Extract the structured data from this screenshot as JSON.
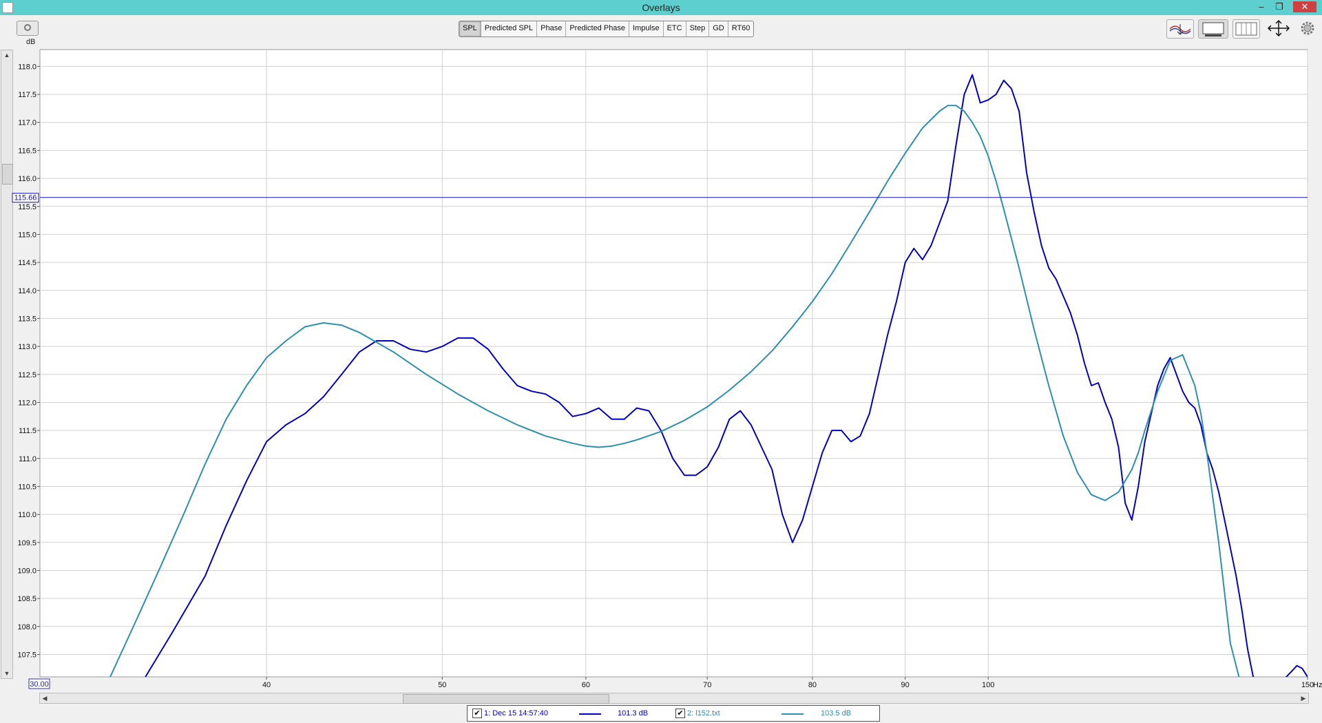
{
  "window": {
    "title": "Overlays",
    "minimize": "–",
    "restore": "❐",
    "close": "✕"
  },
  "toolbar": {
    "unit_label": "dB",
    "tabs": [
      {
        "label": "SPL",
        "active": true
      },
      {
        "label": "Predicted SPL",
        "active": false
      },
      {
        "label": "Phase",
        "active": false
      },
      {
        "label": "Predicted Phase",
        "active": false
      },
      {
        "label": "Impulse",
        "active": false
      },
      {
        "label": "ETC",
        "active": false
      },
      {
        "label": "Step",
        "active": false
      },
      {
        "label": "GD",
        "active": false
      },
      {
        "label": "RT60",
        "active": false
      }
    ],
    "icons": [
      "camera-icon",
      "traces-icon",
      "panel-icon",
      "columns-icon",
      "resize-arrows-icon",
      "gear-icon"
    ]
  },
  "cursor": {
    "value": 115.66,
    "label": "115.66"
  },
  "x_start_label": "30.00",
  "x_unit": "Hz",
  "chart_data": {
    "type": "line",
    "xscale": "log",
    "xlim": [
      30,
      150
    ],
    "ylim": [
      107.1,
      118.3
    ],
    "xticks": [
      40,
      50,
      60,
      70,
      80,
      90,
      100,
      150
    ],
    "yticks": [
      107.5,
      108.0,
      108.5,
      109.0,
      109.5,
      110.0,
      110.5,
      111.0,
      111.5,
      112.0,
      112.5,
      113.0,
      113.5,
      114.0,
      114.5,
      115.0,
      115.5,
      116.0,
      116.5,
      117.0,
      117.5,
      118.0
    ],
    "grid": true,
    "series": [
      {
        "name": "1: Dec 15 14:57:40",
        "level": "101.3 dB",
        "color": "#0000c0",
        "x": [
          34.3,
          35.5,
          37.0,
          38.0,
          39.0,
          40.0,
          41.0,
          42.0,
          43.0,
          44.0,
          45.0,
          46.0,
          47.0,
          48.0,
          49.0,
          50.0,
          51.0,
          52.0,
          53.0,
          54.0,
          55.0,
          56.0,
          57.0,
          58.0,
          59.0,
          60.0,
          61.0,
          62.0,
          63.0,
          64.0,
          65.0,
          66.0,
          67.0,
          68.0,
          69.0,
          70.0,
          71.0,
          72.0,
          73.0,
          74.0,
          75.0,
          76.0,
          77.0,
          78.0,
          79.0,
          80.0,
          81.0,
          82.0,
          83.0,
          84.0,
          85.0,
          86.0,
          87.0,
          88.0,
          89.0,
          90.0,
          91.0,
          92.0,
          93.0,
          94.0,
          95.0,
          96.0,
          97.0,
          98.0,
          99.0,
          100.0,
          101.0,
          102.0,
          103.0,
          104.0,
          105.0,
          106.0,
          107.0,
          108.0,
          109.0,
          110.0,
          111.0,
          112.0,
          113.0,
          114.0,
          115.0,
          116.0,
          117.0,
          118.0,
          119.0,
          120.0,
          121.0,
          122.0,
          123.0,
          124.0,
          125.0,
          126.0,
          127.0,
          128.0,
          129.0,
          130.0,
          131.0,
          132.0,
          133.0,
          134.0,
          135.0,
          136.0,
          137.0,
          138.0,
          139.0,
          140.0,
          141.0,
          142.0,
          143.0,
          144.0,
          145.0,
          146.0,
          147.0,
          148.0,
          149.0,
          150.0
        ],
        "y": [
          107.1,
          107.9,
          108.9,
          109.8,
          110.6,
          111.3,
          111.6,
          111.8,
          112.1,
          112.5,
          112.9,
          113.1,
          113.1,
          112.95,
          112.9,
          113.0,
          113.15,
          113.15,
          112.95,
          112.6,
          112.3,
          112.2,
          112.15,
          112.0,
          111.75,
          111.8,
          111.9,
          111.7,
          111.7,
          111.9,
          111.85,
          111.5,
          111.0,
          110.7,
          110.7,
          110.85,
          111.2,
          111.7,
          111.85,
          111.6,
          111.2,
          110.8,
          110.0,
          109.5,
          109.9,
          110.5,
          111.1,
          111.5,
          111.5,
          111.3,
          111.4,
          111.8,
          112.5,
          113.2,
          113.8,
          114.5,
          114.75,
          114.55,
          114.8,
          115.2,
          115.6,
          116.6,
          117.5,
          117.85,
          117.35,
          117.4,
          117.5,
          117.75,
          117.6,
          117.2,
          116.1,
          115.4,
          114.8,
          114.4,
          114.2,
          113.9,
          113.6,
          113.2,
          112.7,
          112.3,
          112.35,
          112.0,
          111.7,
          111.2,
          110.2,
          109.9,
          110.5,
          111.3,
          111.8,
          112.3,
          112.6,
          112.8,
          112.5,
          112.2,
          112.0,
          111.9,
          111.6,
          111.1,
          110.8,
          110.4,
          109.9,
          109.4,
          108.9,
          108.3,
          107.6,
          107.1,
          106.9,
          106.8,
          106.8,
          106.9,
          107.0,
          107.1,
          107.2,
          107.3,
          107.25,
          107.1
        ],
        "note": ""
      },
      {
        "name": "2: l152.txt",
        "level": "103.5 dB",
        "color": "#2a8fb0",
        "x": [
          32.8,
          34.0,
          35.0,
          36.0,
          37.0,
          38.0,
          39.0,
          40.0,
          41.0,
          42.0,
          43.0,
          44.0,
          45.0,
          47.0,
          49.0,
          51.0,
          53.0,
          55.0,
          57.0,
          59.0,
          60.0,
          61.0,
          62.0,
          63.0,
          64.0,
          66.0,
          68.0,
          70.0,
          72.0,
          74.0,
          76.0,
          78.0,
          80.0,
          82.0,
          84.0,
          86.0,
          88.0,
          90.0,
          92.0,
          94.0,
          95.0,
          96.0,
          97.0,
          98.0,
          99.0,
          100.0,
          101.0,
          102.0,
          104.0,
          106.0,
          108.0,
          110.0,
          112.0,
          114.0,
          116.0,
          118.0,
          120.0,
          121.0,
          122.0,
          124.0,
          126.0,
          128.0,
          130.0,
          131.0,
          132.0,
          133.0,
          134.0,
          135.0,
          136.0,
          138.0,
          140.0,
          142.0,
          144.0,
          146.0
        ],
        "y": [
          107.1,
          108.2,
          109.1,
          110.0,
          110.9,
          111.7,
          112.3,
          112.8,
          113.1,
          113.35,
          113.42,
          113.38,
          113.25,
          112.9,
          112.5,
          112.15,
          111.85,
          111.6,
          111.4,
          111.27,
          111.22,
          111.2,
          111.22,
          111.27,
          111.33,
          111.48,
          111.68,
          111.92,
          112.22,
          112.55,
          112.92,
          113.35,
          113.8,
          114.3,
          114.85,
          115.4,
          115.95,
          116.45,
          116.9,
          117.2,
          117.3,
          117.3,
          117.2,
          117.0,
          116.75,
          116.4,
          115.95,
          115.45,
          114.4,
          113.3,
          112.3,
          111.4,
          110.75,
          110.35,
          110.25,
          110.4,
          110.8,
          111.1,
          111.5,
          112.2,
          112.75,
          112.85,
          112.3,
          111.8,
          111.1,
          110.3,
          109.5,
          108.6,
          107.7,
          106.9,
          106.6,
          106.6,
          106.6,
          106.6
        ],
        "note": ""
      }
    ]
  }
}
